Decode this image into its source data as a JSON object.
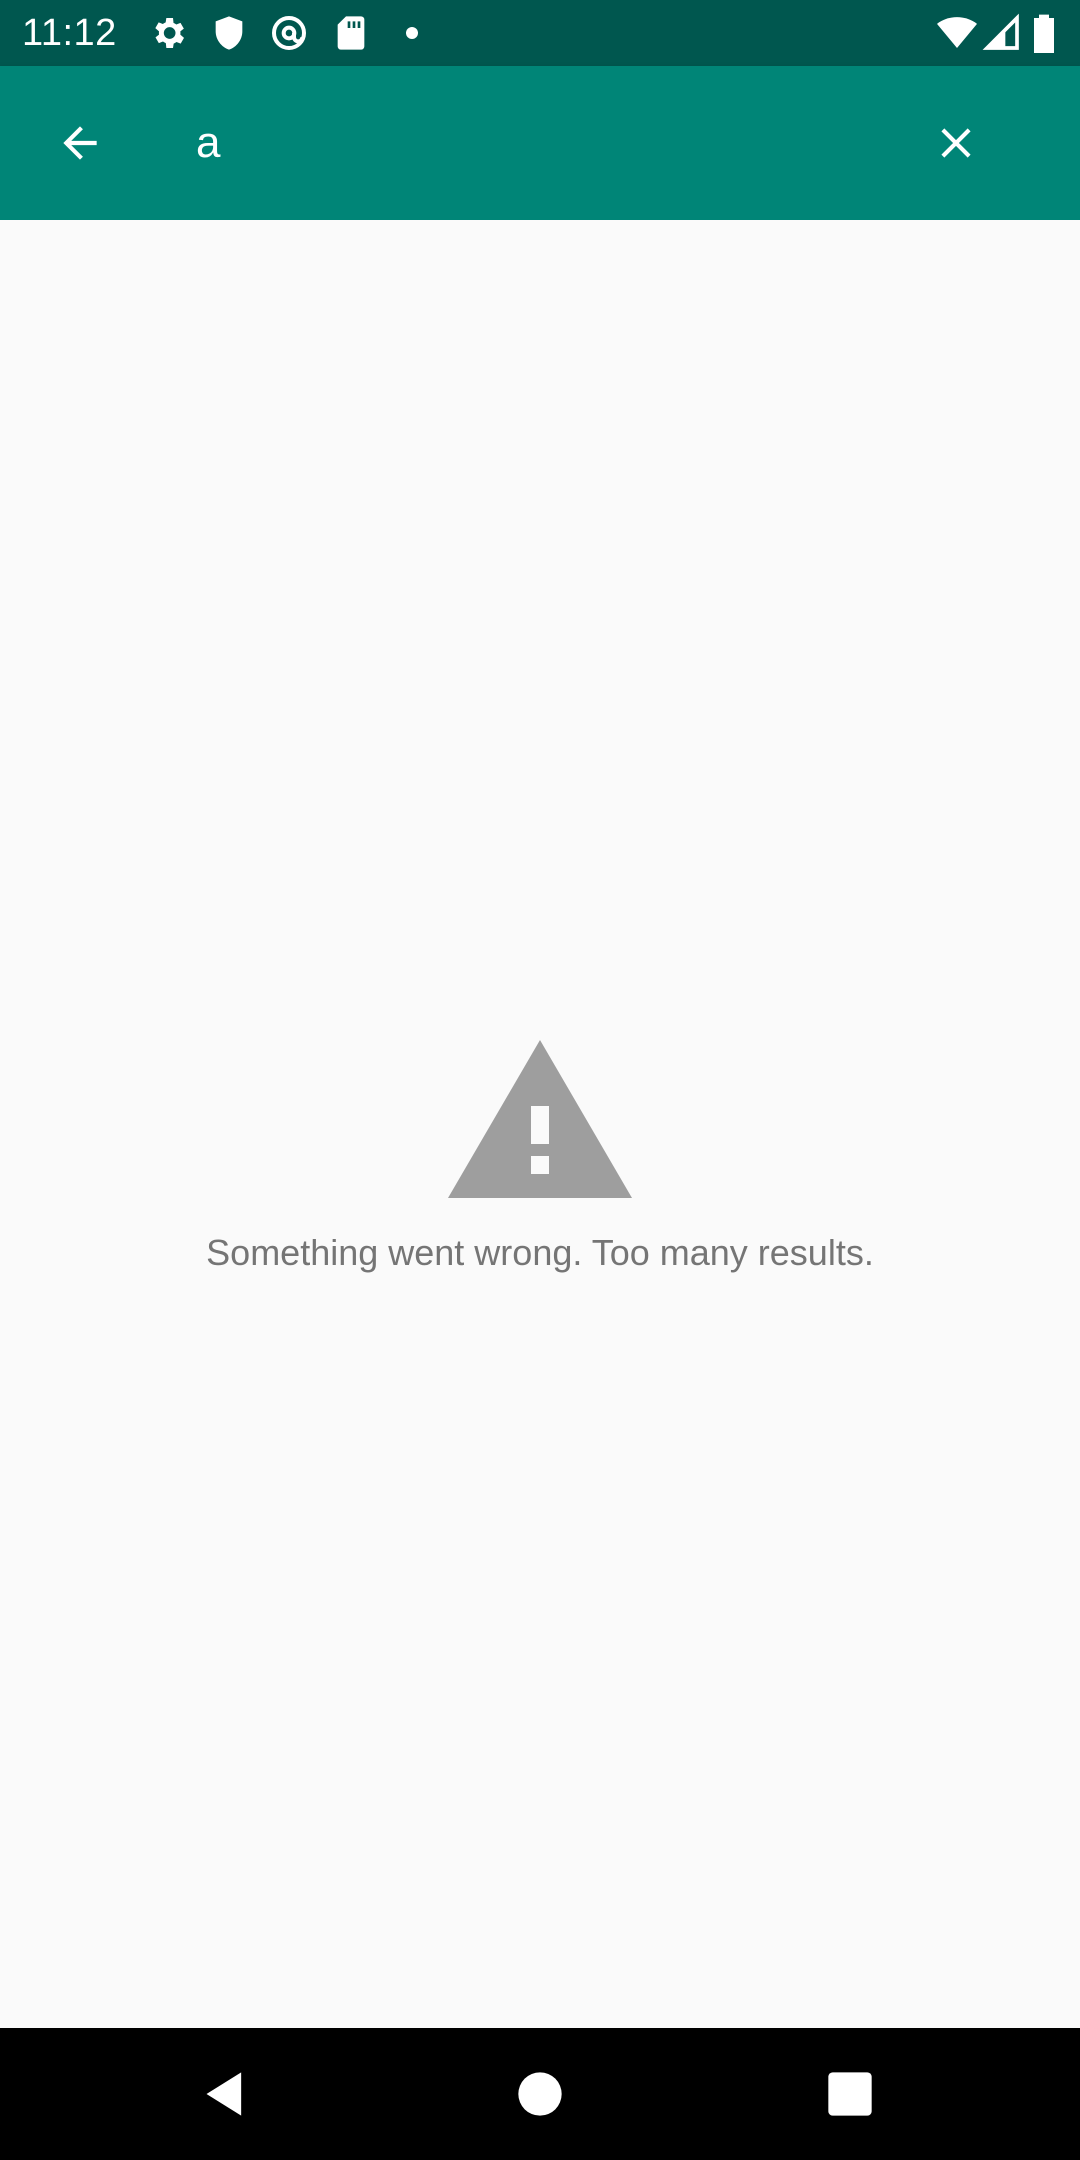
{
  "status_bar": {
    "time": "11:12",
    "left_icons": [
      "gear-icon",
      "shield-icon",
      "at-sync-icon",
      "sd-card-icon",
      "dot-icon"
    ],
    "right_icons": [
      "wifi-icon",
      "cell-signal-icon",
      "battery-icon"
    ]
  },
  "app_bar": {
    "back_icon": "arrow-back-icon",
    "search_value": "a",
    "clear_icon": "close-icon",
    "background": "#008577"
  },
  "error": {
    "icon": "warning-icon",
    "message": "Something went wrong. Too many results."
  },
  "nav_bar": {
    "items": [
      "back-triangle-icon",
      "home-circle-icon",
      "recents-square-icon"
    ]
  },
  "colors": {
    "status_bar": "#00574f",
    "app_bar": "#008577",
    "background": "#fafafa",
    "error_text": "#757575",
    "warning_icon": "#9e9e9e"
  }
}
